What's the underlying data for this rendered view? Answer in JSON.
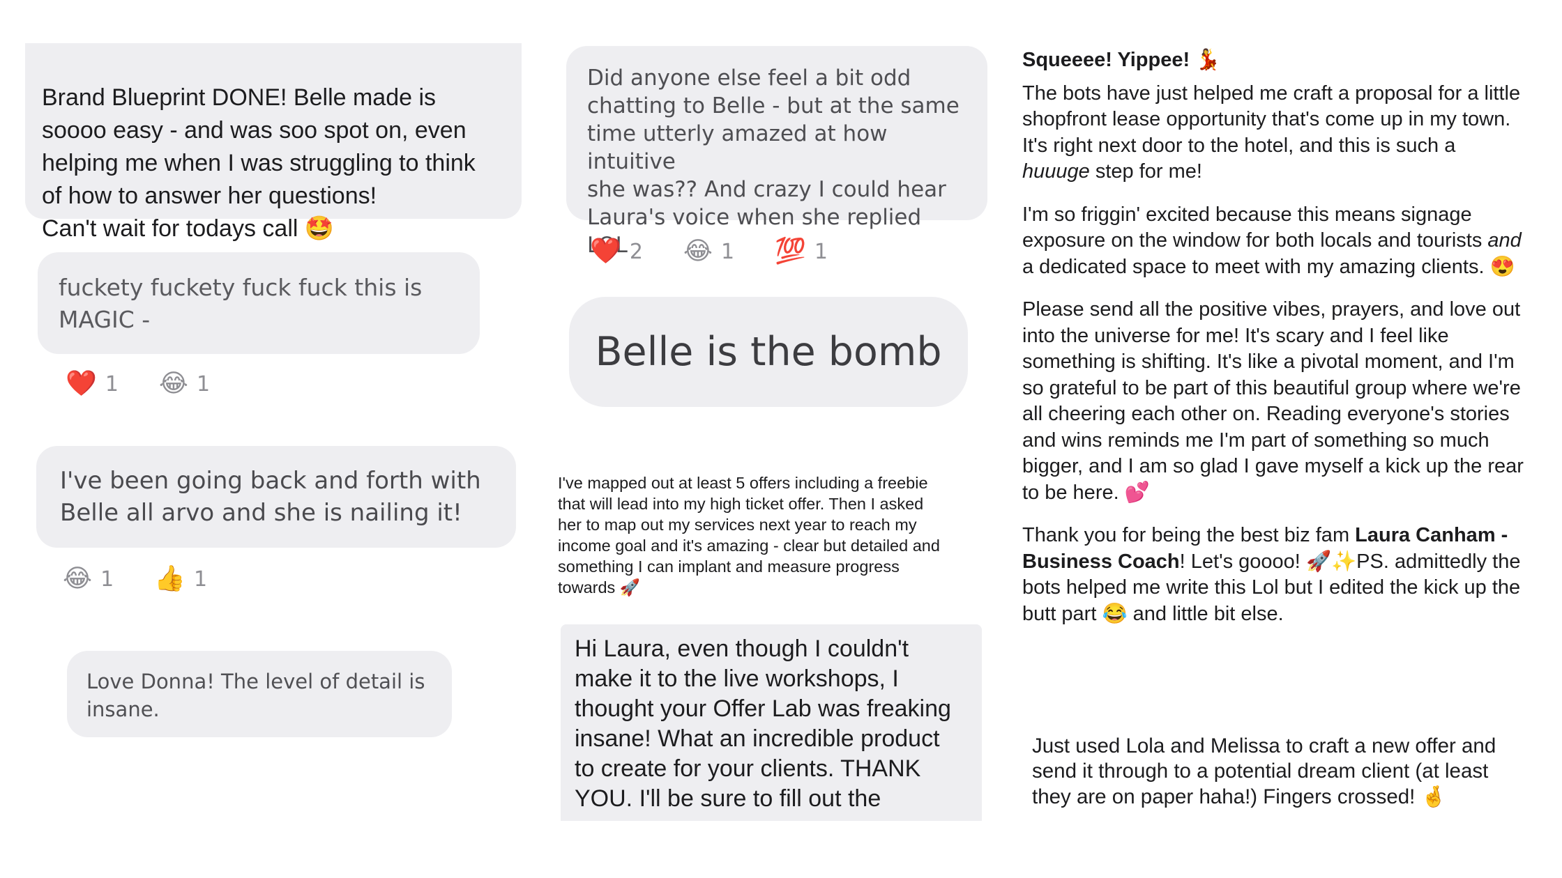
{
  "col1": {
    "bubble1": {
      "text": "Brand Blueprint DONE! Belle made is\nsoooo easy - and was soo spot on, even\nhelping me when I was struggling to think\nof how to answer her questions!\nCan't wait for todays call",
      "emoji": "🤩"
    },
    "bubble2": {
      "text": "fuckety fuckety fuck fuck this is\nMAGIC -"
    },
    "reactions2": [
      {
        "emoji": "❤️",
        "count": "1"
      },
      {
        "emoji": "😂",
        "count": "1"
      }
    ],
    "bubble3": {
      "text": "I've been going back and forth with\nBelle all arvo and she is nailing it!"
    },
    "reactions3": [
      {
        "emoji": "😂",
        "count": "1"
      },
      {
        "emoji": "👍",
        "count": "1"
      }
    ],
    "bubble4": {
      "text": "Love Donna! The level of detail is\ninsane."
    }
  },
  "col2": {
    "bubble1": {
      "text": "Did anyone else feel a bit odd\nchatting to Belle - but at the same\ntime utterly amazed at how intuitive\nshe was?? And crazy I could hear\nLaura's voice when she replied LOL"
    },
    "reactions1": [
      {
        "emoji": "❤️",
        "count": "2"
      },
      {
        "emoji": "😂",
        "count": "1"
      },
      {
        "emoji": "💯",
        "count": "1"
      }
    ],
    "bubble2": {
      "text": "Belle is the bomb"
    },
    "post": {
      "text": "I've mapped out at least 5 offers including a freebie\nthat will lead into my high ticket offer. Then I asked\nher to map out my services next year to reach my\nincome goal and it's amazing - clear but detailed and\nsomething I can implant and measure progress\ntowards",
      "emoji": "🚀"
    },
    "bubble3": {
      "text": "Hi Laura, even though I couldn't\nmake it to the live workshops, I\nthought your Offer Lab was freaking\ninsane! What an incredible product\nto create for your clients. THANK\nYOU. I'll be sure to fill out the"
    }
  },
  "col3": {
    "heading": "Squeeee! Yippee!",
    "heading_emoji": "💃",
    "p1_a": "The bots have just helped me craft a proposal for a little\nshopfront lease opportunity that's come up in my town.\nIt's right next door to the hotel, and this is such a\n",
    "p1_em": "huuuge",
    "p1_b": " step for me!",
    "p2_a": "I'm so friggin' excited because this means signage\nexposure on the window for both locals and tourists ",
    "p2_em": "and",
    "p2_b": "\na dedicated space to meet with my amazing clients.",
    "p2_emoji": "😍",
    "p3": "Please send all the positive vibes, prayers, and love out\ninto the universe for me! It's scary and I feel like\nsomething is shifting. It's like a pivotal moment, and I'm\nso grateful to be part of this beautiful group where we're\nall cheering each other on. Reading everyone's stories\nand wins reminds me I'm part of something so much\nbigger, and I am so glad I gave myself a kick up the rear\nto be here.",
    "p3_emoji": "💕",
    "p4_a": "Thank you for being the best biz fam ",
    "p4_bold": "Laura Canham -\nBusiness Coach",
    "p4_b": "! Let's goooo!",
    "p4_emoji1": "🚀",
    "p4_emoji2": "✨",
    "p4_c": "PS. admittedly the\nbots helped me write this Lol but I edited the kick up the\nbutt part",
    "p4_emoji3": "😂",
    "p4_d": " and little bit else.",
    "post2": "Just used Lola and Melissa to craft a new offer and\nsend it through to a potential dream client (at least\nthey are on paper haha!) Fingers crossed!",
    "post2_emoji": "🤞"
  }
}
